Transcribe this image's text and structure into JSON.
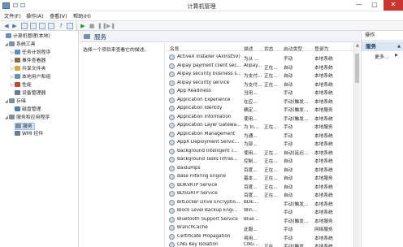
{
  "window": {
    "title": "计算机管理",
    "controls": [
      "—",
      "▢",
      "✕"
    ]
  },
  "menu": [
    "文件(F)",
    "操作(A)",
    "查看(V)",
    "帮助(H)"
  ],
  "toolbar": {
    "icons": [
      "back-icon",
      "forward-icon",
      "up-icon",
      "properties-icon",
      "refresh-icon",
      "export-icon",
      "help-icon",
      "view-icon",
      "play-icon",
      "stop-icon",
      "pause-icon",
      "restart-icon"
    ]
  },
  "tree": [
    {
      "label": "计算机管理(本地)",
      "expander": "",
      "level": 0,
      "color": "#6b8fb8"
    },
    {
      "label": "系统工具",
      "expander": "◢",
      "level": 1,
      "color": "#7f8f9f"
    },
    {
      "label": "任务计划程序",
      "expander": "▷",
      "level": 2,
      "color": "#5a8fc9"
    },
    {
      "label": "事件查看器",
      "expander": "▷",
      "level": 2,
      "color": "#8a6a4a"
    },
    {
      "label": "共享文件夹",
      "expander": "▷",
      "level": 2,
      "color": "#d6a93c"
    },
    {
      "label": "本地用户和组",
      "expander": "▷",
      "level": 2,
      "color": "#6d8fb2"
    },
    {
      "label": "性能",
      "expander": "▷",
      "level": 2,
      "color": "#c04a3a"
    },
    {
      "label": "设备管理器",
      "expander": "",
      "level": 2,
      "color": "#6b7c8c"
    },
    {
      "label": "存储",
      "expander": "◢",
      "level": 1,
      "color": "#7f8f9f"
    },
    {
      "label": "磁盘管理",
      "expander": "",
      "level": 2,
      "color": "#4f7fb0"
    },
    {
      "label": "服务和应用程序",
      "expander": "◢",
      "level": 1,
      "color": "#7f8f9f"
    },
    {
      "label": "服务",
      "expander": "",
      "level": 2,
      "color": "#7c8fa5"
    },
    {
      "label": "WMI 控件",
      "expander": "",
      "level": 2,
      "color": "#6b7c8c"
    }
  ],
  "main": {
    "title": "服务",
    "description_hint": "选择一个项目来查看它的描述。",
    "columns": [
      "名称",
      "描述",
      "状态",
      "启动类型",
      "登录为"
    ],
    "rows": [
      {
        "name": "ActiveX Installer (AxInstSV)",
        "desc": "为从 ...",
        "status": "",
        "startup": "手动",
        "logon": "本地系统"
      },
      {
        "name": "Alipay payment client sec...",
        "desc": "Alipay...",
        "status": "正在...",
        "startup": "自动",
        "logon": "本地系统"
      },
      {
        "name": "Alipay security business s...",
        "desc": "为支付...",
        "status": "正在...",
        "startup": "自动",
        "logon": "本地系统"
      },
      {
        "name": "Alipay security service",
        "desc": "为支付...",
        "status": "正在...",
        "startup": "自动",
        "logon": "本地系统"
      },
      {
        "name": "App Readiness",
        "desc": "当用...",
        "status": "",
        "startup": "手动",
        "logon": "本地系统"
      },
      {
        "name": "Application Experience",
        "desc": "在应...",
        "status": "",
        "startup": "手动(触发...",
        "logon": "本地系统"
      },
      {
        "name": "Application Identity",
        "desc": "确定...",
        "status": "",
        "startup": "手动(触发...",
        "logon": "本地服务"
      },
      {
        "name": "Application Information",
        "desc": "使用...",
        "status": "",
        "startup": "手动(触发...",
        "logon": "本地系统"
      },
      {
        "name": "Application Layer Gatewa...",
        "desc": "为 In...",
        "status": "正在...",
        "startup": "手动",
        "logon": "本地服务"
      },
      {
        "name": "Application Management",
        "desc": "为通...",
        "status": "",
        "startup": "手动",
        "logon": "本地系统"
      },
      {
        "name": "AppX Deployment Servic...",
        "desc": "为部...",
        "status": "",
        "startup": "手动",
        "logon": "本地系统"
      },
      {
        "name": "Background Intelligent T...",
        "desc": "使用...",
        "status": "正在...",
        "startup": "自动(延迟...",
        "logon": "本地系统"
      },
      {
        "name": "Background Tasks Infras...",
        "desc": "控制...",
        "status": "正在...",
        "startup": "自动",
        "logon": "本地系统"
      },
      {
        "name": "BaiduHips",
        "desc": "百度...",
        "status": "正在...",
        "startup": "自动",
        "logon": "本地系统"
      },
      {
        "name": "Base Filtering Engine",
        "desc": "基本...",
        "status": "正在...",
        "startup": "自动",
        "logon": "本地服务"
      },
      {
        "name": "BDKVRTP Service",
        "desc": "百度...",
        "status": "正在...",
        "startup": "自动",
        "logon": "本地系统"
      },
      {
        "name": "BDSGRTP Service",
        "desc": "百度...",
        "status": "正在...",
        "startup": "自动",
        "logon": "本地系统"
      },
      {
        "name": "BitLocker Drive Encryptio...",
        "desc": "BDE...",
        "status": "",
        "startup": "手动(触发...",
        "logon": "本地系统"
      },
      {
        "name": "Block Level Backup Engi...",
        "desc": "Win...",
        "status": "",
        "startup": "手动",
        "logon": "本地系统"
      },
      {
        "name": "Bluetooth Support Service",
        "desc": "Blue...",
        "status": "",
        "startup": "手动(触发...",
        "logon": "本地服务"
      },
      {
        "name": "BranchCache",
        "desc": "此服...",
        "status": "",
        "startup": "手动",
        "logon": "网络服务"
      },
      {
        "name": "Certificate Propagation",
        "desc": "将用...",
        "status": "",
        "startup": "手动",
        "logon": "本地系统"
      },
      {
        "name": "CNG Key Isolation",
        "desc": "CNG...",
        "status": "正在...",
        "startup": "手动(触发...",
        "logon": "本地系统"
      }
    ]
  },
  "actions": {
    "header": "操作",
    "section": "服务",
    "more": "更多...",
    "caret_up": "▲",
    "caret_right": "▶"
  }
}
